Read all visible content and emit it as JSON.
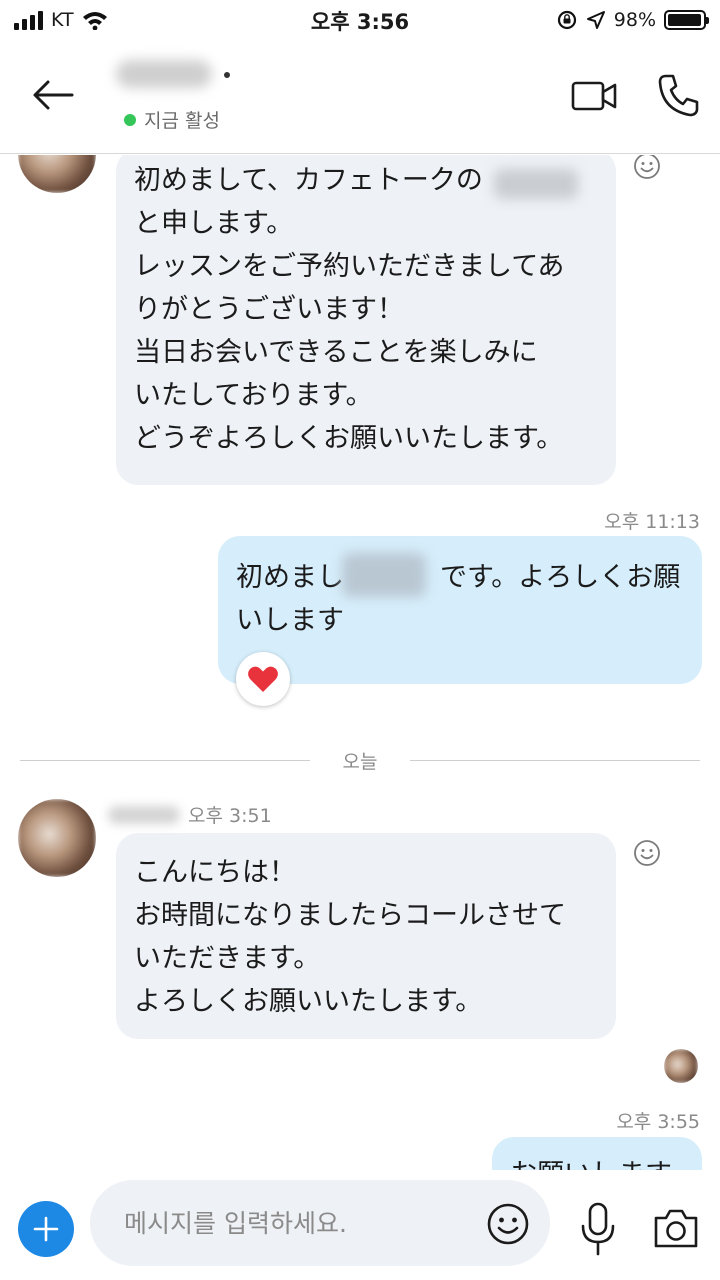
{
  "status_bar": {
    "carrier": "KT",
    "time": "오후 3:56",
    "battery": "98%",
    "battery_level": 0.98
  },
  "header": {
    "presence": "지금 활성"
  },
  "messages": [
    {
      "direction": "incoming",
      "text": "初めまして、カフェトークの\nと申します。\nレッスンをご予約いただきましてあ\nりがとうございます！\n当日お会いできることを楽しみに\nいたしております。\nどうぞよろしくお願いいたします。"
    },
    {
      "direction": "outgoing",
      "time": "오후 11:13",
      "text_start": "初めまし",
      "text_end": "です。よろしくお願",
      "text_line2": "いします",
      "reaction": "heart"
    },
    {
      "direction": "incoming",
      "time": "오후 3:51",
      "text": "こんにちは！\nお時間になりましたらコールさせて\nいただきます。\nよろしくお願いいたします。"
    },
    {
      "direction": "outgoing",
      "time": "오후 3:55",
      "text": "お願いします"
    }
  ],
  "divider": {
    "label": "오늘"
  },
  "composer": {
    "placeholder": "메시지를 입력하세요."
  },
  "colors": {
    "accent": "#1e88e5",
    "presence": "#35c65a",
    "incoming_bubble": "#eef2f7",
    "outgoing_bubble": "#d6eefb",
    "heart": "#e8333c"
  }
}
